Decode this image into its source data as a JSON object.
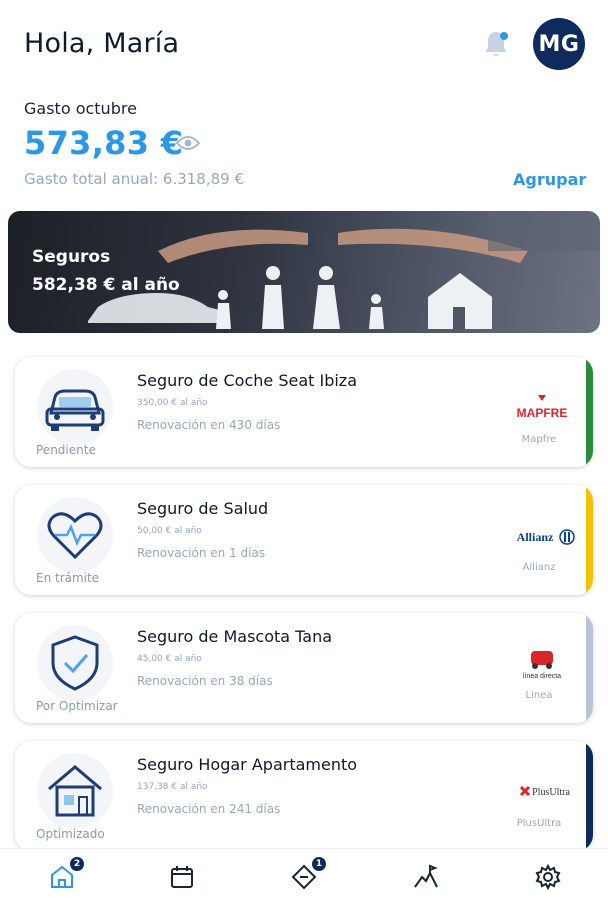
{
  "header": {
    "greeting": "Hola, María",
    "avatar_initials": "MG",
    "notification_icon": "bell-icon"
  },
  "summary": {
    "label": "Gasto octubre",
    "amount": "573,83 €",
    "visibility_icon": "eye-icon",
    "annual_total": "Gasto total anual: 6.318,89 €",
    "group_action": "Agrupar"
  },
  "banner": {
    "title": "Seguros",
    "subtitle": "582,38 € al año"
  },
  "policies": [
    {
      "title": "Seguro de Coche Seat Ibiza",
      "price": "350,00 € al año",
      "renewal": "Renovación en 430 días",
      "status": "Pendiente",
      "provider": "Mapfre",
      "logo_text": "MAPFRE",
      "icon": "car-icon",
      "accent": "#2e8b3e"
    },
    {
      "title": "Seguro de Salud",
      "price": "50,00 € al año",
      "renewal": "Renovación en 1 días",
      "status": "En trámite",
      "provider": "Allianz",
      "logo_text": "Allianz",
      "icon": "heart-pulse-icon",
      "accent": "#f2c200"
    },
    {
      "title": "Seguro de Mascota Tana",
      "price": "45,00 € al año",
      "renewal": "Renovación en 38 días",
      "status": "Por Optimizar",
      "provider": "Linea",
      "logo_text": "línea directa",
      "icon": "shield-check-icon",
      "accent": "#b9c4d6"
    },
    {
      "title": "Seguro Hogar Apartamento",
      "price": "137,38 € al año",
      "renewal": "Renovación en 241 días",
      "status": "Optimizado",
      "provider": "PlusUltra",
      "logo_text": "PlusUltra",
      "icon": "house-icon",
      "accent": "#0f2a5c"
    }
  ],
  "nav": {
    "home_badge": "2",
    "tickets_badge": "1",
    "items": [
      "home-icon",
      "calendar-icon",
      "ticket-icon",
      "path-icon",
      "settings-icon"
    ]
  },
  "colors": {
    "primary": "#2c97e8",
    "navy": "#0f2a5c",
    "muted": "#9aa7b9"
  }
}
